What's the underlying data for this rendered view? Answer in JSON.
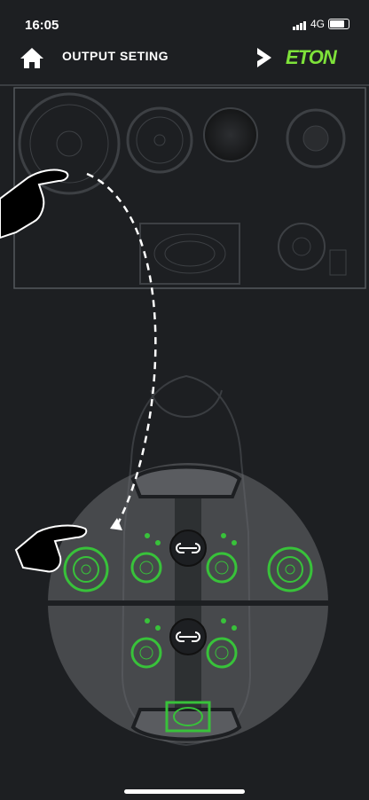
{
  "status": {
    "time": "16:05",
    "network": "4G"
  },
  "header": {
    "title": "OUTPUT SETING",
    "brand": "ETON"
  },
  "colors": {
    "accent": "#7ee23a",
    "background": "#1d1f22",
    "speaker_on": "#38c23a"
  },
  "icons": [
    "home-icon",
    "chevron-right-icon",
    "hand-pointer-icon",
    "link-icon"
  ]
}
